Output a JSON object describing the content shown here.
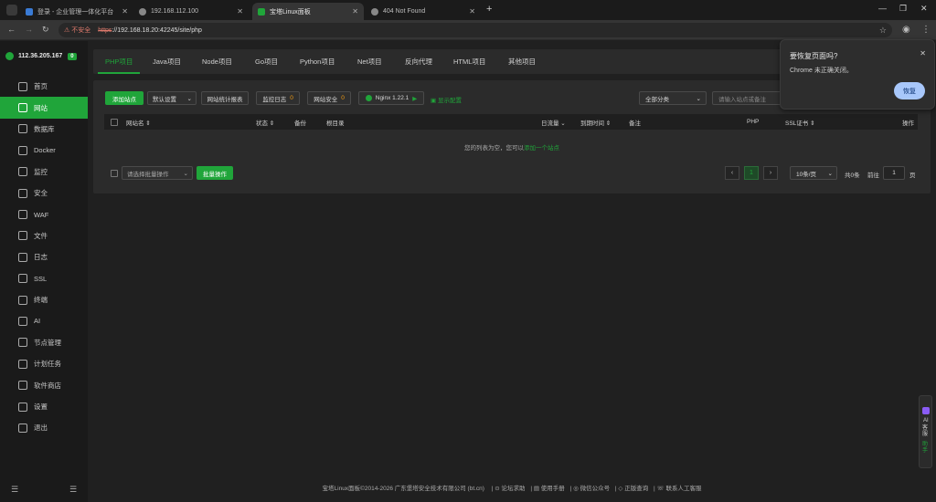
{
  "browser": {
    "tabs": [
      {
        "title": "登录 - 企业管理一体化平台",
        "active": false,
        "fav_color": "#3a7bd5"
      },
      {
        "title": "192.168.112.100",
        "active": false,
        "fav_color": "#888888"
      },
      {
        "title": "宝塔Linux面板",
        "active": true,
        "fav_color": "#20a53a"
      },
      {
        "title": "404 Not Found",
        "active": false,
        "fav_color": "#888888"
      }
    ],
    "insecure_label": "不安全",
    "url_scheme": "https",
    "url_rest": "://192.168.18.20:42245/site/php"
  },
  "sidebar": {
    "ip": "112.36.205.167",
    "badge": "0",
    "items": [
      {
        "label": "首页",
        "icon": "home-icon"
      },
      {
        "label": "网站",
        "icon": "website-icon",
        "active": true
      },
      {
        "label": "数据库",
        "icon": "database-icon"
      },
      {
        "label": "Docker",
        "icon": "docker-icon"
      },
      {
        "label": "监控",
        "icon": "monitor-icon"
      },
      {
        "label": "安全",
        "icon": "shield-icon"
      },
      {
        "label": "WAF",
        "icon": "waf-icon"
      },
      {
        "label": "文件",
        "icon": "folder-icon"
      },
      {
        "label": "日志",
        "icon": "log-icon"
      },
      {
        "label": "SSL",
        "icon": "ssl-icon"
      },
      {
        "label": "终端",
        "icon": "terminal-icon"
      },
      {
        "label": "AI",
        "icon": "ai-icon"
      },
      {
        "label": "节点管理",
        "icon": "node-icon"
      },
      {
        "label": "计划任务",
        "icon": "schedule-icon"
      },
      {
        "label": "软件商店",
        "icon": "store-icon"
      },
      {
        "label": "设置",
        "icon": "settings-icon"
      },
      {
        "label": "退出",
        "icon": "logout-icon"
      }
    ]
  },
  "project_tabs": [
    "PHP项目",
    "Java项目",
    "Node项目",
    "Go项目",
    "Python项目",
    "Net项目",
    "反向代理",
    "HTML项目",
    "其他项目"
  ],
  "toolbar": {
    "add_site": "添加站点",
    "default_page": "默认设置",
    "stats": "网站统计报表",
    "mon_log": "监控日志",
    "mon_count": "0",
    "site_security": "网站安全",
    "sec_count": "0",
    "nginx": "Nginx 1.22.1",
    "nginx_action": "显示配置",
    "category": "全部分类",
    "search_placeholder": "请输入站点或备注"
  },
  "table": {
    "headers": [
      "网站名",
      "状态",
      "备份",
      "根目录",
      "日流量",
      "到期时间",
      "备注",
      "PHP",
      "SSL证书",
      "操作"
    ],
    "empty_text": "您的列表为空，您可以",
    "empty_link": "添加一个站点"
  },
  "batch": {
    "select_placeholder": "请选择批量操作",
    "button": "批量操作"
  },
  "pagination": {
    "current": "1",
    "per_page": "10条/页",
    "total": "共0条",
    "goto_label": "前往",
    "goto_value": "1",
    "page_suffix": "页"
  },
  "popup": {
    "title": "要恢复页面吗?",
    "text": "Chrome 未正确关闭。",
    "button": "恢复"
  },
  "footer": {
    "copyright": "宝塔Linux面板©2014-2026 广东堡塔安全技术有限公司 (bt.cn)",
    "links": [
      "论坛求助",
      "使用手册",
      "微信公众号",
      "正版查询",
      "联系人工客服"
    ]
  },
  "float_widget": {
    "label1": "AI",
    "label2": "客服",
    "label3": "助手"
  }
}
